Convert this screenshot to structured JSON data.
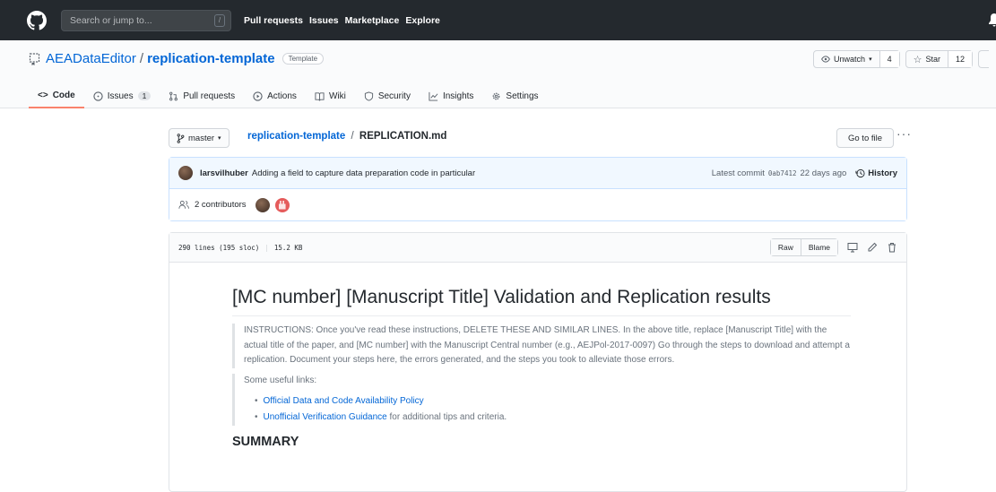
{
  "header": {
    "search_placeholder": "Search or jump to...",
    "search_key": "/",
    "nav": [
      "Pull requests",
      "Issues",
      "Marketplace",
      "Explore"
    ]
  },
  "repo": {
    "owner": "AEADataEditor",
    "separator": "/",
    "name": "replication-template",
    "badge": "Template",
    "watch_label": "Unwatch",
    "watch_count": "4",
    "star_label": "Star",
    "star_count": "12"
  },
  "tabs": [
    {
      "label": "Code",
      "icon": "code-icon",
      "active": true
    },
    {
      "label": "Issues",
      "icon": "issue-icon",
      "count": "1"
    },
    {
      "label": "Pull requests",
      "icon": "pull-request-icon"
    },
    {
      "label": "Actions",
      "icon": "play-icon"
    },
    {
      "label": "Wiki",
      "icon": "book-icon"
    },
    {
      "label": "Security",
      "icon": "shield-icon"
    },
    {
      "label": "Insights",
      "icon": "graph-icon"
    },
    {
      "label": "Settings",
      "icon": "gear-icon"
    }
  ],
  "file": {
    "branch": "master",
    "crumb_repo": "replication-template",
    "crumb_sep": "/",
    "filename": "REPLICATION.md",
    "goto_label": "Go to file",
    "more": "···"
  },
  "commit": {
    "author": "larsvilhuber",
    "message": "Adding a field to capture data preparation code in particular",
    "latest_label": "Latest commit",
    "sha": "0ab7412",
    "age": "22 days ago",
    "history_label": "History",
    "contributors": "2 contributors"
  },
  "filebar": {
    "lines": "290 lines (195 sloc)",
    "size": "15.2 KB",
    "raw": "Raw",
    "blame": "Blame"
  },
  "content": {
    "title": "[MC number] [Manuscript Title] Validation and Replication results",
    "instructions": "INSTRUCTIONS: Once you've read these instructions, DELETE THESE AND SIMILAR LINES. In the above title, replace [Manuscript Title] with the actual title of the paper, and [MC number] with the Manuscript Central number (e.g., AEJPol-2017-0097) Go through the steps to download and attempt a replication. Document your steps here, the errors generated, and the steps you took to alleviate those errors.",
    "links_intro": "Some useful links:",
    "link1": "Official Data and Code Availability Policy",
    "link2": "Unofficial Verification Guidance",
    "link2_suffix": " for additional tips and criteria.",
    "summary": "SUMMARY"
  }
}
